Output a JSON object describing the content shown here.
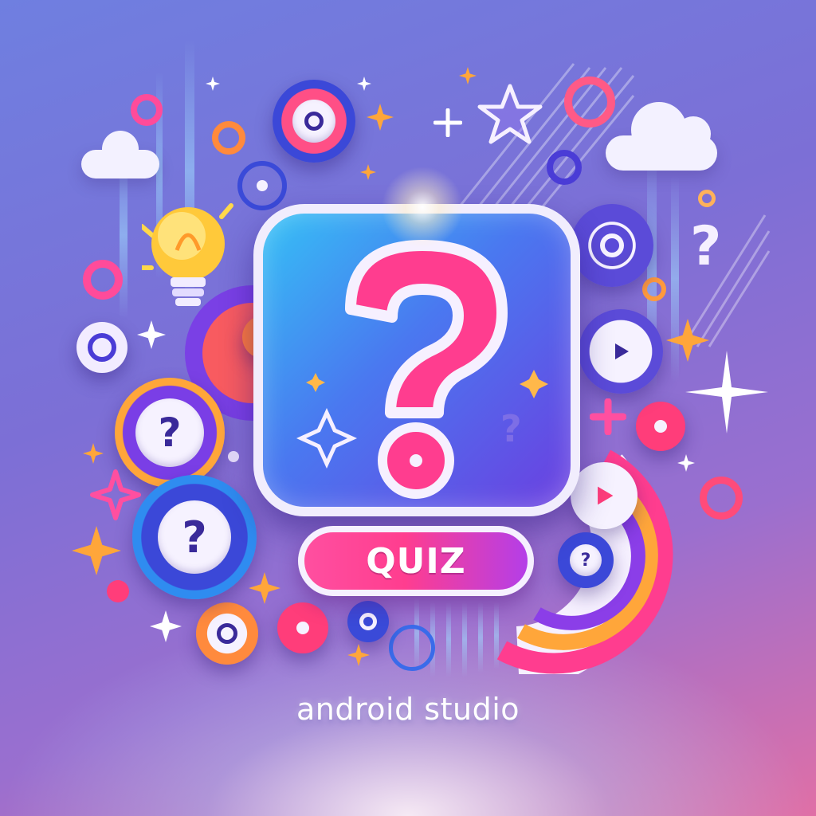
{
  "brand": {
    "button_label": "QUIZ",
    "tagline": "android studio"
  },
  "icons": {
    "hero": "question-mark-icon",
    "small_badges": [
      "question-mark-icon",
      "question-mark-icon",
      "play-icon",
      "play-icon",
      "target-icon",
      "lightbulb-icon",
      "cloud-icon",
      "star-icon",
      "sparkle-icon"
    ]
  },
  "colors": {
    "background_start": "#6f7fe0",
    "background_end": "#e06fa6",
    "card_start": "#35c0f5",
    "card_end": "#6b3fe0",
    "accent_pink": "#ff3d8f",
    "accent_orange": "#ffa63a",
    "accent_purple": "#8b3ee8"
  }
}
